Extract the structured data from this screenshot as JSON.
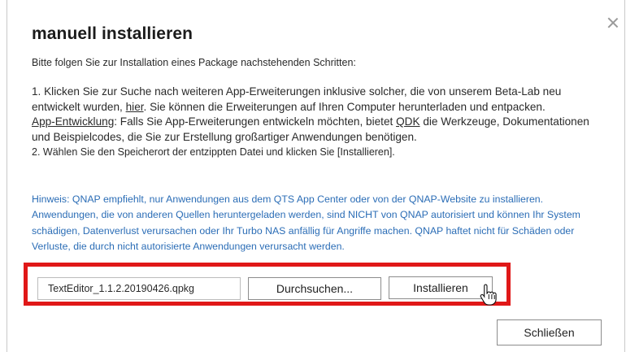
{
  "dialog": {
    "title": "manuell installieren",
    "intro": "Bitte folgen Sie zur Installation eines Package nachstehenden Schritten:",
    "step1_pre": "1. Klicken Sie zur Suche nach weiteren App-Erweiterungen inklusive solcher, die von unserem Beta-Lab neu entwickelt wurden, ",
    "step1_link": "hier",
    "step1_post": ". Sie können die Erweiterungen auf Ihren Computer herunterladen und entpacken.",
    "dev_link": "App-Entwicklung",
    "dev_pre": ": Falls Sie App-Erweiterungen entwickeln möchten, bietet ",
    "qdk_link": "QDK",
    "dev_post": " die Werkzeuge, Dokumentationen und Beispielcodes, die Sie zur Erstellung großartiger Anwendungen benötigen.",
    "step2": "2. Wählen Sie den Speicherort der entzippten Datei und klicken Sie [Installieren].",
    "hint_label": "Hinweis",
    "hint_text": ": QNAP empfiehlt, nur Anwendungen aus dem QTS App Center oder von der QNAP-Website zu installieren. Anwendungen, die von anderen Quellen heruntergeladen werden, sind NICHT von QNAP autorisiert und können Ihr System schädigen, Datenverlust verursachen oder Ihr Turbo NAS anfällig für Angriffe machen. QNAP haftet nicht für Schäden oder Verluste, die durch nicht autorisierte Anwendungen verursacht werden.",
    "file_value": "TextEditor_1.1.2.20190426.qpkg",
    "browse_label": "Durchsuchen...",
    "install_label": "Installieren",
    "close_label": "Schließen"
  },
  "colors": {
    "highlight": "#e01818",
    "hint_text": "#2b6db6"
  },
  "icons": {
    "close": "close-icon",
    "cursor": "hand-pointer-icon"
  }
}
